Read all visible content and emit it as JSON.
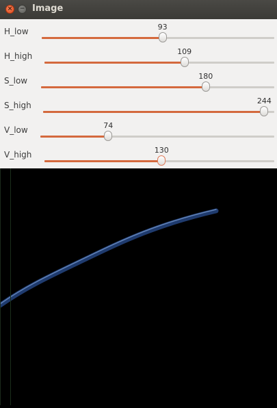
{
  "window": {
    "title": "Image",
    "close_glyph": "×",
    "minimize_glyph": "−"
  },
  "trackbars": [
    {
      "label": "H_low",
      "value": "93",
      "max": 179
    },
    {
      "label": "H_high",
      "value": "109",
      "max": 179
    },
    {
      "label": "S_low",
      "value": "180",
      "max": 255
    },
    {
      "label": "S_high",
      "value": "244",
      "max": 255
    },
    {
      "label": "V_low",
      "value": "74",
      "max": 255
    },
    {
      "label": "V_high",
      "value": "130",
      "max": 255
    }
  ],
  "colors": {
    "fill": "#d4693d",
    "track": "#cfcdc9",
    "image_background": "#000000",
    "curve": "#1f3b6e",
    "curve_highlight": "#6d8fc4"
  }
}
